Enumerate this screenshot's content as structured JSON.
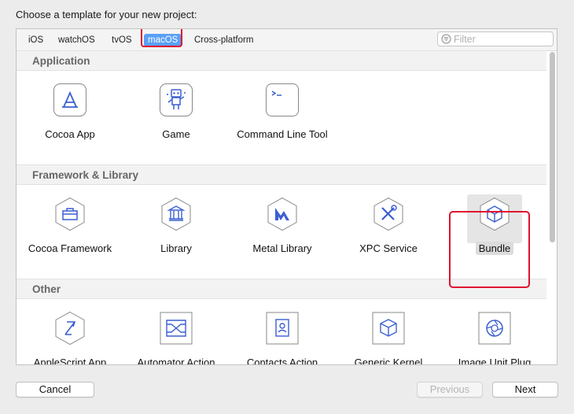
{
  "heading": "Choose a template for your new project:",
  "tabs": [
    {
      "label": "iOS",
      "selected": false
    },
    {
      "label": "watchOS",
      "selected": false
    },
    {
      "label": "tvOS",
      "selected": false
    },
    {
      "label": "macOS",
      "selected": true
    },
    {
      "label": "Cross-platform",
      "selected": false
    }
  ],
  "filter": {
    "placeholder": "Filter",
    "value": ""
  },
  "sections": [
    {
      "title": "Application",
      "items": [
        {
          "label": "Cocoa App",
          "icon": "app-store-icon"
        },
        {
          "label": "Game",
          "icon": "game-robot-icon"
        },
        {
          "label": "Command Line Tool",
          "icon": "terminal-icon"
        }
      ]
    },
    {
      "title": "Framework & Library",
      "items": [
        {
          "label": "Cocoa Framework",
          "icon": "toolbox-icon"
        },
        {
          "label": "Library",
          "icon": "library-building-icon"
        },
        {
          "label": "Metal Library",
          "icon": "metal-icon"
        },
        {
          "label": "XPC Service",
          "icon": "tools-icon"
        },
        {
          "label": "Bundle",
          "icon": "bundle-box-icon",
          "selected": true
        }
      ]
    },
    {
      "title": "Other",
      "items": [
        {
          "label": "AppleScript App",
          "icon": "applescript-icon"
        },
        {
          "label": "Automator Action",
          "icon": "automator-icon"
        },
        {
          "label": "Contacts Action",
          "icon": "contacts-icon"
        },
        {
          "label": "Generic Kernel",
          "icon": "kernel-box-icon"
        },
        {
          "label": "Image Unit Plug",
          "icon": "aperture-icon"
        }
      ]
    }
  ],
  "buttons": {
    "cancel": "Cancel",
    "previous": "Previous",
    "next": "Next"
  },
  "colors": {
    "accent": "#5aa0f6",
    "highlight": "#e0102f",
    "icon_stroke": "#3b5fd0"
  }
}
